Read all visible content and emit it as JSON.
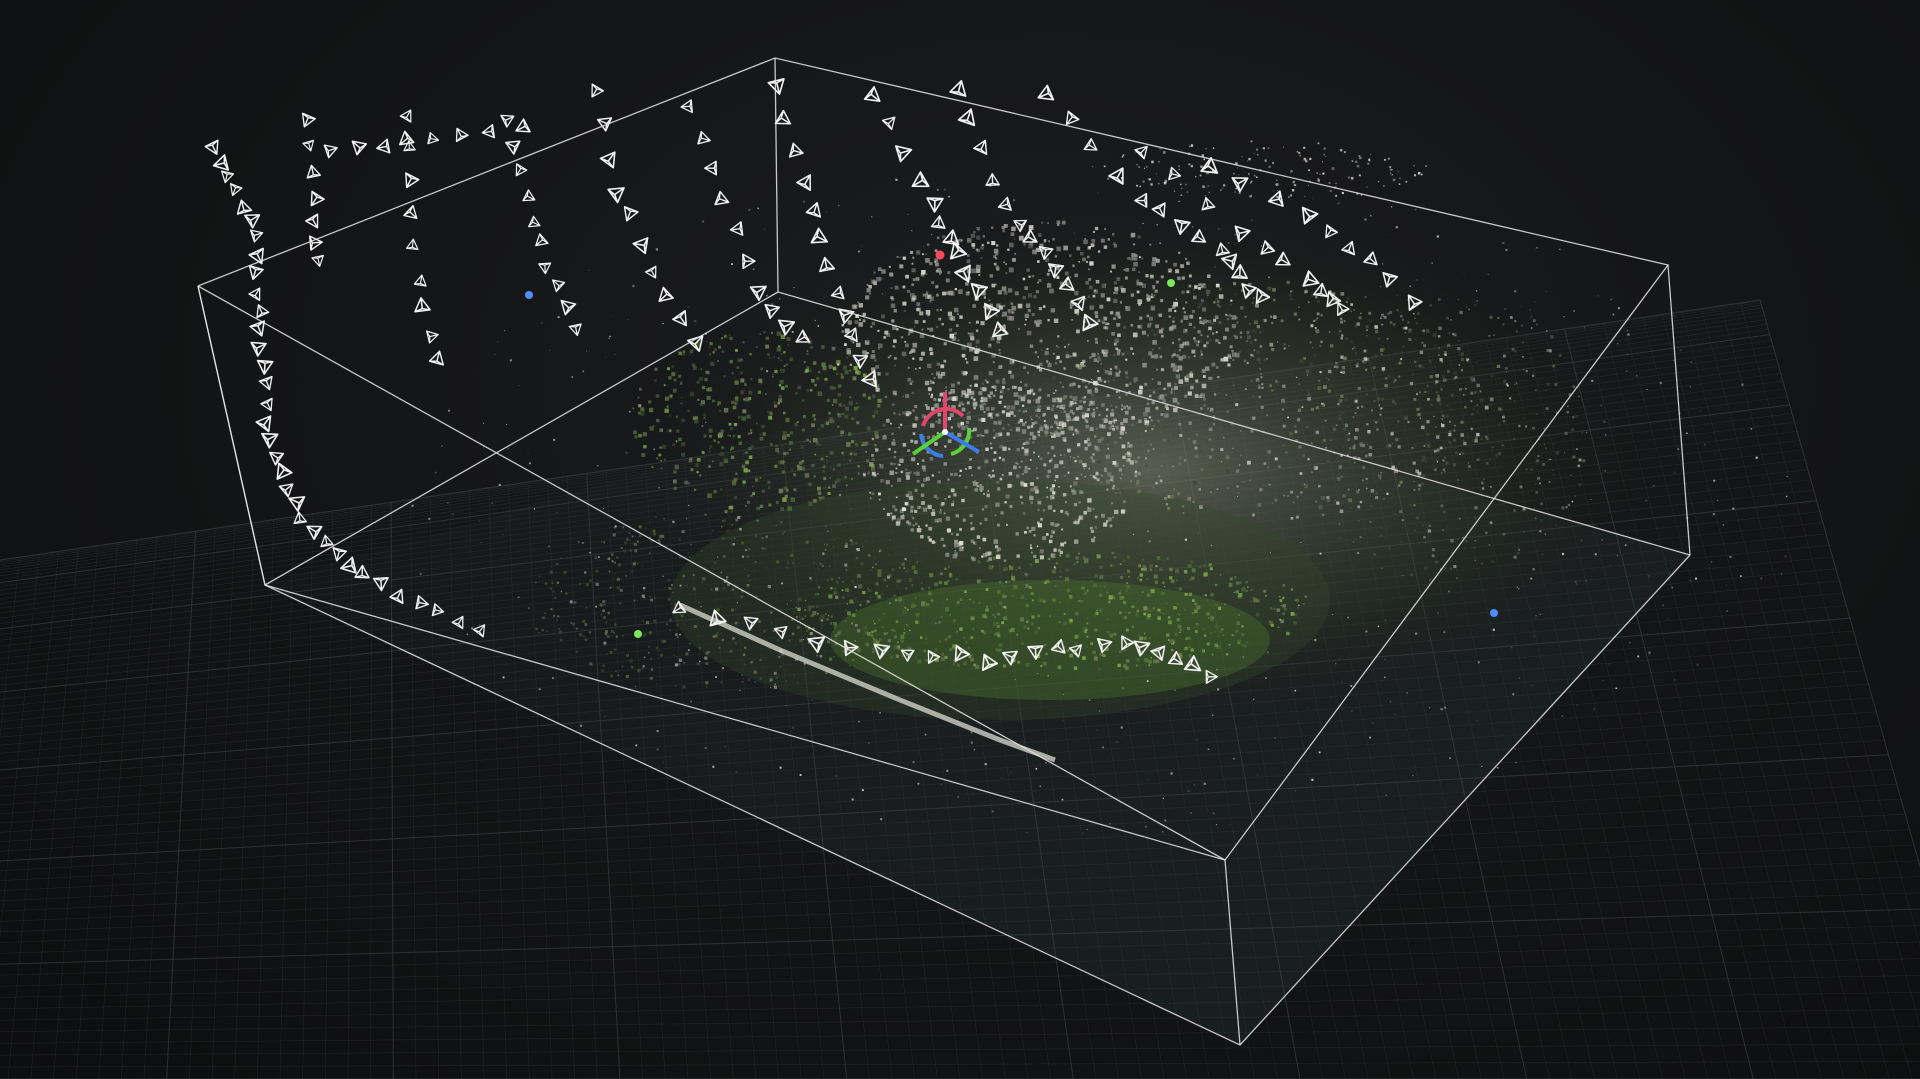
{
  "viewport": {
    "background_color": "#131415",
    "grid_color": "#3a3d40",
    "bounding_box_color": "#e6e6e6",
    "point_cloud_colors": [
      "#9a9a92",
      "#c8c6bc",
      "#6f7a5a",
      "#4f6e36",
      "#7fa84a",
      "#e0dfd6",
      "#3f4a3a"
    ],
    "camera_frustum_color": "#f2f2f2"
  },
  "gizmo": {
    "icon": "transform-gizmo-icon",
    "x_axis_color": "#e0476a",
    "y_axis_color": "#5ad13c",
    "z_axis_color": "#3b7ce6"
  },
  "control_points": [
    {
      "icon": "control-point-red-icon",
      "color": "#ff4b5c"
    },
    {
      "icon": "control-point-green-icon",
      "color": "#7ee85a"
    },
    {
      "icon": "control-point-blue-icon",
      "color": "#4e8cff"
    },
    {
      "icon": "control-point-green-icon",
      "color": "#7ee85a"
    },
    {
      "icon": "control-point-blue-icon",
      "color": "#4e8cff"
    }
  ]
}
